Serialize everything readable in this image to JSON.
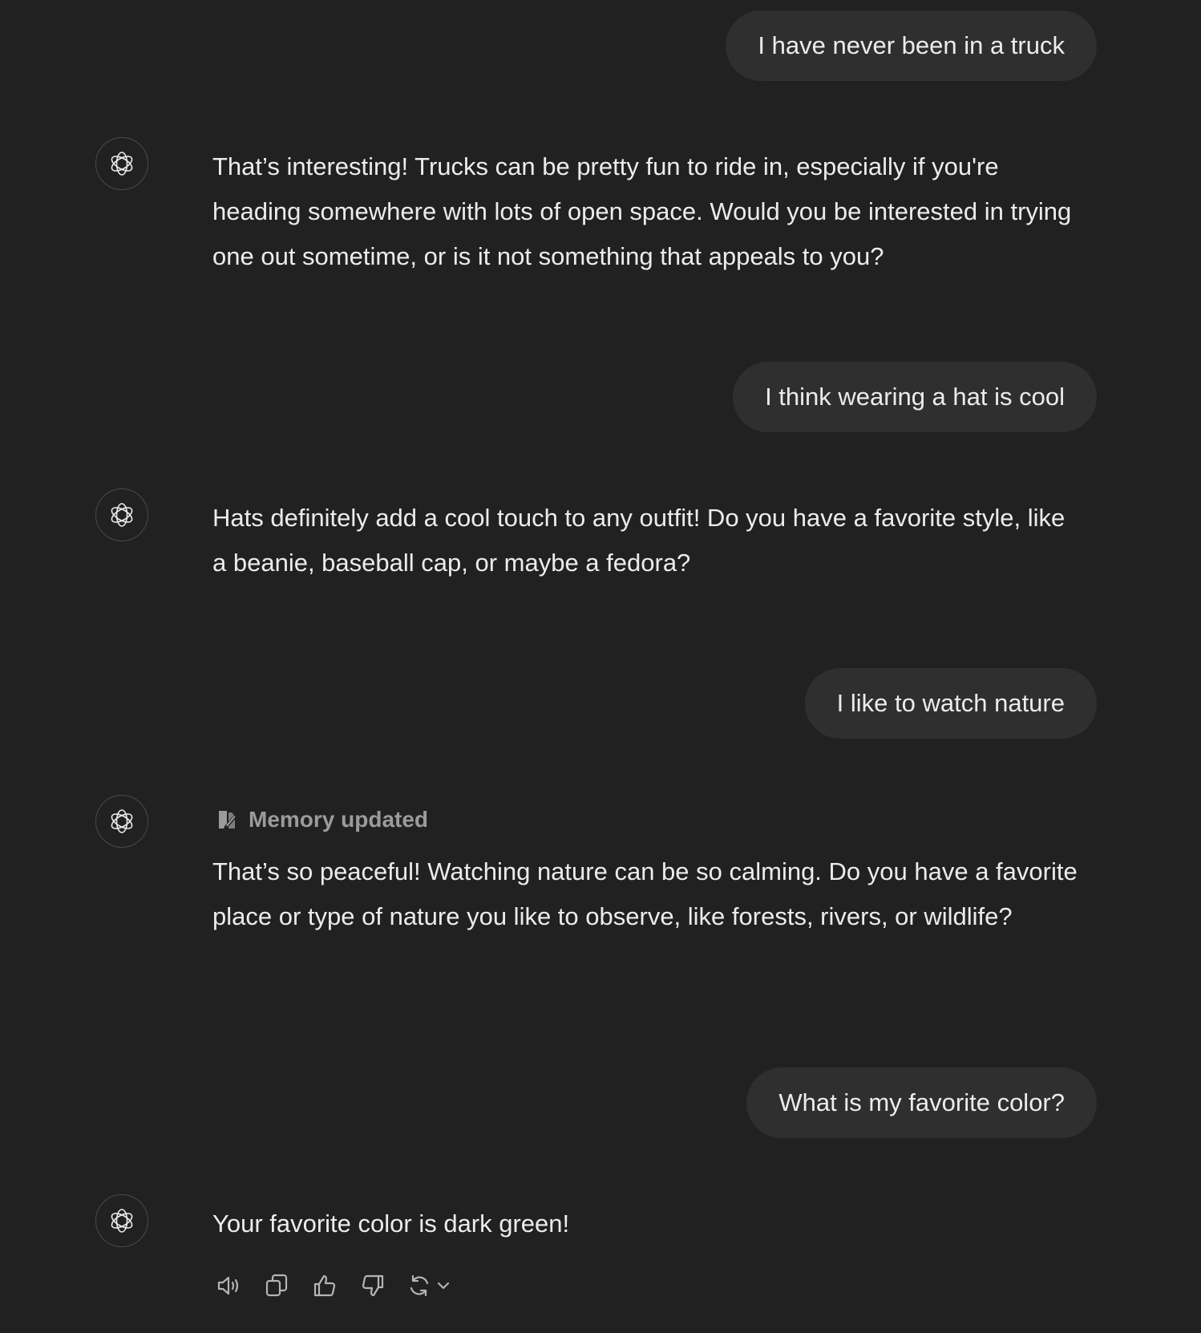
{
  "conversation": {
    "messages": [
      {
        "role": "user",
        "text": "I have never been in a truck"
      },
      {
        "role": "assistant",
        "text": "That’s interesting! Trucks can be pretty fun to ride in, especially if you're heading somewhere with lots of open space. Would you be interested in trying one out sometime, or is it not something that appeals to you?"
      },
      {
        "role": "user",
        "text": "I think wearing a hat is cool"
      },
      {
        "role": "assistant",
        "text": "Hats definitely add a cool touch to any outfit! Do you have a favorite style, like a beanie, baseball cap, or maybe a fedora?"
      },
      {
        "role": "user",
        "text": "I like to watch nature"
      },
      {
        "role": "assistant",
        "memory_note": "Memory updated",
        "text": "That’s so peaceful! Watching nature can be so calming. Do you have a favorite place or type of nature you like to observe, like forests, rivers, or wildlife?"
      },
      {
        "role": "user",
        "text": "What is my favorite color?"
      },
      {
        "role": "assistant",
        "text": "Your favorite color is dark green!"
      }
    ]
  },
  "avatar_icon": "openai-logo-icon",
  "memory_icon": "memory-edit-icon",
  "message_actions": [
    {
      "name": "read-aloud",
      "icon": "speaker-icon"
    },
    {
      "name": "copy",
      "icon": "copy-icon"
    },
    {
      "name": "good-response",
      "icon": "thumbs-up-icon"
    },
    {
      "name": "bad-response",
      "icon": "thumbs-down-icon"
    },
    {
      "name": "regenerate",
      "icon": "refresh-icon"
    }
  ],
  "colors": {
    "background": "#212121",
    "user_bubble": "#2f2f2f",
    "text": "#ececec",
    "muted_text": "#9b9b9b"
  }
}
